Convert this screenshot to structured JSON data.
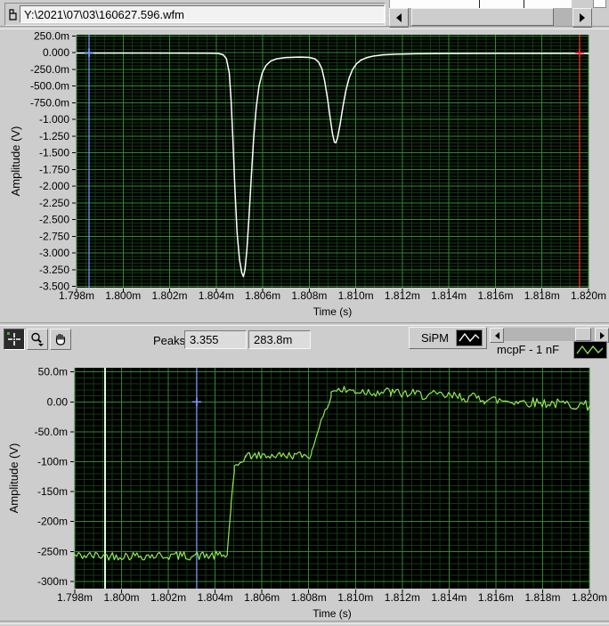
{
  "header": {
    "path_value": "Y:\\2021\\07\\03\\160627.596.wfm"
  },
  "toolbar": {
    "peaks_label": "Peaks",
    "peak_values": [
      "3.355",
      "283.8m"
    ],
    "tools": [
      "cursor-movement",
      "zoom",
      "pan"
    ]
  },
  "legends": {
    "sipm": "SiPM",
    "mcp": "mcpF - 1 nF"
  },
  "colors": {
    "panel": "#cdcdcd",
    "plot_bg": "#000000",
    "grid_major": "#2e8b2e",
    "grid_minor": "#143814",
    "trace_top": "#ffffff",
    "trace_bottom": "#94e850",
    "cursor_blue": "#6f9eff",
    "cursor_red": "#ff2222",
    "cursor_pale": "#dcffdc"
  },
  "chart_data": [
    {
      "id": "top",
      "type": "line",
      "xlabel": "Time (s)",
      "ylabel": "Amplitude (V)",
      "xlim": [
        1.798,
        1.82
      ],
      "ylim": [
        -3.5,
        0.25
      ],
      "grid": {
        "x_major": 0.002,
        "x_minor": 0.0004,
        "y_major": 0.25,
        "y_minor": 0.05
      },
      "x_ticks": {
        "labels": [
          "1.798m",
          "1.800m",
          "1.802m",
          "1.804m",
          "1.806m",
          "1.808m",
          "1.810m",
          "1.812m",
          "1.814m",
          "1.816m",
          "1.818m",
          "1.820m"
        ],
        "values": [
          1.798,
          1.8,
          1.802,
          1.804,
          1.806,
          1.808,
          1.81,
          1.812,
          1.814,
          1.816,
          1.818,
          1.82
        ]
      },
      "y_ticks": {
        "labels": [
          "250.0m",
          "0.000",
          "-250.0m",
          "-500.0m",
          "-750.0m",
          "-1.000",
          "-1.250",
          "-1.500",
          "-1.750",
          "-2.000",
          "-2.250",
          "-2.500",
          "-2.750",
          "-3.000",
          "-3.250",
          "-3.500"
        ],
        "values": [
          0.25,
          0,
          -0.25,
          -0.5,
          -0.75,
          -1,
          -1.25,
          -1.5,
          -1.75,
          -2,
          -2.25,
          -2.5,
          -2.75,
          -3,
          -3.25,
          -3.5
        ]
      },
      "series": [
        {
          "name": "SiPM",
          "color": "#ffffff",
          "points": [
            [
              1.798,
              -0.005
            ],
            [
              1.801,
              -0.005
            ],
            [
              1.8035,
              -0.006
            ],
            [
              1.80408,
              -0.01
            ],
            [
              1.8043,
              -0.03
            ],
            [
              1.80444,
              -0.09
            ],
            [
              1.80456,
              -0.3
            ],
            [
              1.80464,
              -0.7
            ],
            [
              1.80472,
              -1.3
            ],
            [
              1.8048,
              -2.0
            ],
            [
              1.8049,
              -2.7
            ],
            [
              1.805,
              -3.1
            ],
            [
              1.8051,
              -3.3
            ],
            [
              1.80517,
              -3.355
            ],
            [
              1.80524,
              -3.25
            ],
            [
              1.80532,
              -2.95
            ],
            [
              1.80541,
              -2.45
            ],
            [
              1.80551,
              -1.85
            ],
            [
              1.80561,
              -1.28
            ],
            [
              1.80572,
              -0.82
            ],
            [
              1.80584,
              -0.5
            ],
            [
              1.80598,
              -0.3
            ],
            [
              1.80614,
              -0.19
            ],
            [
              1.80634,
              -0.125
            ],
            [
              1.8066,
              -0.09
            ],
            [
              1.807,
              -0.072
            ],
            [
              1.8076,
              -0.065
            ],
            [
              1.808,
              -0.07
            ],
            [
              1.80824,
              -0.09
            ],
            [
              1.8084,
              -0.14
            ],
            [
              1.80854,
              -0.24
            ],
            [
              1.80866,
              -0.42
            ],
            [
              1.80878,
              -0.68
            ],
            [
              1.8089,
              -0.98
            ],
            [
              1.809,
              -1.22
            ],
            [
              1.80908,
              -1.34
            ],
            [
              1.80914,
              -1.35
            ],
            [
              1.80922,
              -1.27
            ],
            [
              1.80932,
              -1.08
            ],
            [
              1.80944,
              -0.82
            ],
            [
              1.80957,
              -0.57
            ],
            [
              1.80971,
              -0.38
            ],
            [
              1.80986,
              -0.25
            ],
            [
              1.81003,
              -0.165
            ],
            [
              1.81022,
              -0.11
            ],
            [
              1.81045,
              -0.075
            ],
            [
              1.81075,
              -0.05
            ],
            [
              1.81115,
              -0.032
            ],
            [
              1.8117,
              -0.022
            ],
            [
              1.8126,
              -0.015
            ],
            [
              1.814,
              -0.012
            ],
            [
              1.816,
              -0.01
            ],
            [
              1.818,
              -0.01
            ],
            [
              1.82,
              -0.012
            ]
          ]
        }
      ],
      "cursors": [
        {
          "name": "cursor-blue",
          "color": "#6f9eff",
          "t": 1.798536,
          "cross_v": 0
        },
        {
          "name": "cursor-red",
          "color": "#ff2222",
          "t": 1.819617,
          "cross_v": 0
        }
      ]
    },
    {
      "id": "bottom",
      "type": "line",
      "xlabel": "Time (s)",
      "ylabel": "Amplitude (V)",
      "xlim": [
        1.798,
        1.82
      ],
      "ylim": [
        -0.3,
        0.05
      ],
      "grid": {
        "x_major": 0.002,
        "x_minor": 0.0004,
        "y_major": 0.05,
        "y_minor": 0.01
      },
      "x_ticks": {
        "labels": [
          "1.798m",
          "1.800m",
          "1.802m",
          "1.804m",
          "1.806m",
          "1.808m",
          "1.810m",
          "1.812m",
          "1.814m",
          "1.816m",
          "1.818m",
          "1.820m"
        ],
        "values": [
          1.798,
          1.8,
          1.802,
          1.804,
          1.806,
          1.808,
          1.81,
          1.812,
          1.814,
          1.816,
          1.818,
          1.82
        ]
      },
      "y_ticks": {
        "labels": [
          "50.0m",
          "0.00",
          "-50.0m",
          "-100m",
          "-150m",
          "-200m",
          "-250m",
          "-300m"
        ],
        "values": [
          0.05,
          0,
          -0.05,
          -0.1,
          -0.15,
          -0.2,
          -0.25,
          -0.3
        ]
      },
      "series": [
        {
          "name": "mcpF - 1 nF",
          "color": "#94e850",
          "noise_step": 8e-05,
          "segments": [
            [
              1.798,
              -0.257,
              1.80452,
              -0.257,
              0.0075
            ],
            [
              1.80452,
              -0.25,
              1.80468,
              -0.175,
              0.003
            ],
            [
              1.80468,
              -0.17,
              1.80482,
              -0.118,
              0.004
            ],
            [
              1.80482,
              -0.112,
              1.8053,
              -0.092,
              0.005
            ],
            [
              1.8053,
              -0.09,
              1.80812,
              -0.089,
              0.0065
            ],
            [
              1.80812,
              -0.084,
              1.80836,
              -0.052,
              0.004
            ],
            [
              1.80836,
              -0.05,
              1.80896,
              0.008,
              0.004
            ],
            [
              1.80896,
              0.02,
              1.8115,
              0.016,
              0.0085
            ],
            [
              1.8115,
              0.015,
              1.8155,
              0.006,
              0.0085
            ],
            [
              1.8155,
              0.004,
              1.82,
              -0.006,
              0.0085
            ]
          ]
        }
      ],
      "cursors": [
        {
          "name": "cursor-pale",
          "color": "#dcffdc",
          "t": 1.799294
        },
        {
          "name": "cursor-blue",
          "color": "#6f9eff",
          "t": 1.803213,
          "cross_v": 0
        }
      ]
    }
  ]
}
